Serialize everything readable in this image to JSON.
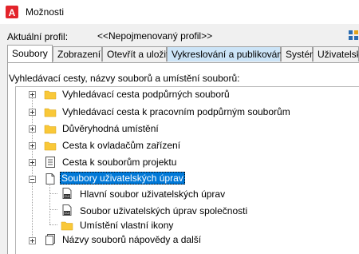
{
  "window": {
    "title": "Možnosti"
  },
  "profile": {
    "label": "Aktuální profil:",
    "value": "<<Nepojmenovaný profil>>"
  },
  "tabs": [
    {
      "label": "Soubory",
      "active": true
    },
    {
      "label": "Zobrazení"
    },
    {
      "label": "Otevřít a uložit"
    },
    {
      "label": "Vykreslování a publikování",
      "highlighted": true
    },
    {
      "label": "Systém"
    },
    {
      "label": "Uživatelské"
    }
  ],
  "panel": {
    "description": "Vyhledávací cesty, názvy souborů a umístění souborů:"
  },
  "tree": {
    "items": [
      {
        "label": "Vyhledávací cesta podpůrných souborů",
        "icon": "folder-icon"
      },
      {
        "label": "Vyhledávací cesta k pracovním podpůrným souborům",
        "icon": "folder-icon"
      },
      {
        "label": "Důvěryhodná umístění",
        "icon": "folder-icon"
      },
      {
        "label": "Cesta k ovladačům zařízení",
        "icon": "folder-icon"
      },
      {
        "label": "Cesta k souborům projektu",
        "icon": "project-file-icon"
      },
      {
        "label": "Soubory uživatelských úprav",
        "icon": "document-icon",
        "expanded": true,
        "selected": true
      },
      {
        "label": "Hlavní soubor uživatelských úprav",
        "icon": "cui-file-icon",
        "child": true
      },
      {
        "label": "Soubor uživatelských úprav společnosti",
        "icon": "cui-file-icon",
        "child": true
      },
      {
        "label": "Umístění vlastní ikony",
        "icon": "folder-icon",
        "child": true
      },
      {
        "label": "Názvy souborů nápovědy a další",
        "icon": "documents-icon"
      }
    ]
  },
  "colors": {
    "selection": "#0078d7",
    "folder": "#f9c838",
    "app_icon": "#e3242b",
    "tab_highlight": "#cce4f7"
  }
}
